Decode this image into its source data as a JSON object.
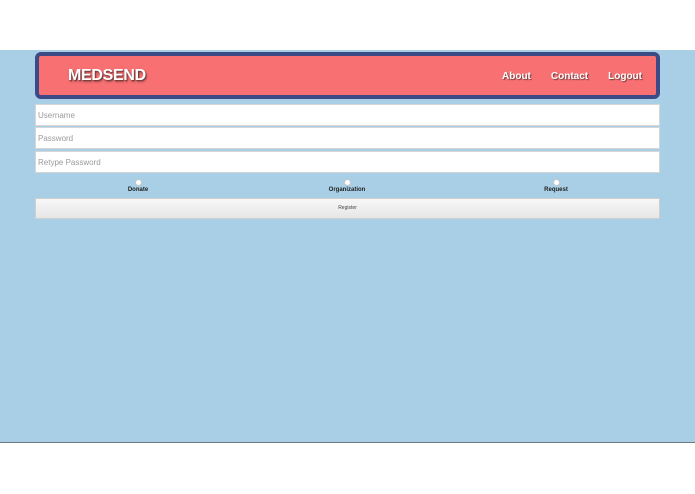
{
  "navbar": {
    "brand": "MEDSEND",
    "links": [
      {
        "label": "About"
      },
      {
        "label": "Contact"
      },
      {
        "label": "Logout"
      }
    ]
  },
  "form": {
    "username": {
      "value": "",
      "placeholder": "Username"
    },
    "password": {
      "value": "",
      "placeholder": "Password"
    },
    "retype_password": {
      "value": "",
      "placeholder": "Retype Password"
    },
    "options": [
      {
        "label": "Donate"
      },
      {
        "label": "Organization"
      },
      {
        "label": "Request"
      }
    ],
    "submit_label": "Register"
  },
  "colors": {
    "background": "#a8cfe6",
    "navbar": "#f87072",
    "navbar_border": "#3c4a86"
  }
}
